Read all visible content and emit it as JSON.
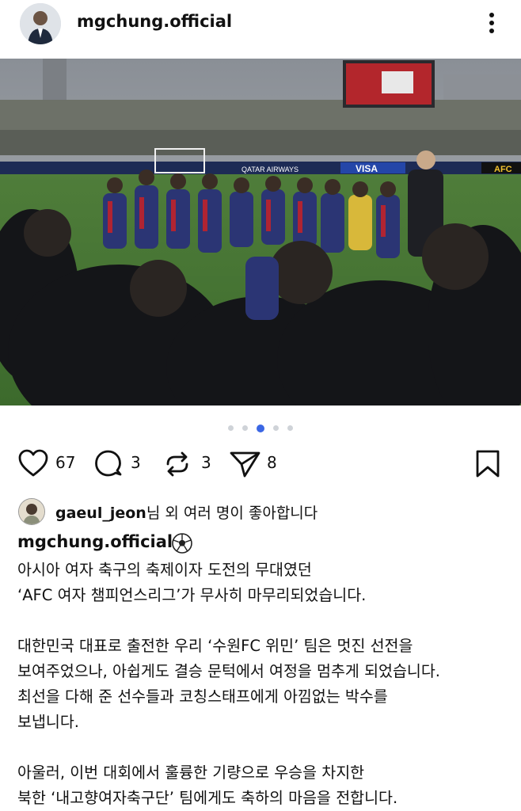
{
  "header": {
    "username": "mgchung.official",
    "avatar_icon": "profile-photo",
    "more_icon": "more-vertical-icon"
  },
  "photo": {
    "stadium_banners": [
      "QATAR AIRWAYS",
      "VISA",
      "AFC"
    ],
    "carousel": {
      "count": 5,
      "active_index": 2
    }
  },
  "actions": {
    "likes": "67",
    "comments": "3",
    "reposts": "3",
    "shares": "8"
  },
  "liked_by": {
    "user": "gaeul_jeon",
    "suffix": "님 외 여러 명이 좋아합니다"
  },
  "caption": {
    "username": "mgchung.official",
    "emoji_icon": "soccer-ball-icon",
    "lines": [
      "아시아 여자 축구의 축제이자 도전의 무대였던",
      "‘AFC 여자 챔피언스리그’가 무사히 마무리되었습니다.",
      "",
      "대한민국 대표로 출전한 우리 ‘수원FC 위민’ 팀은 멋진 선전을",
      "보여주었으나, 아쉽게도 결승 문턱에서 여정을 멈추게 되었습니다.",
      "최선을 다해 준 선수들과 코칭스태프에게 아낌없는 박수를",
      "보냅니다.",
      "",
      "아울러, 이번 대회에서 훌륭한 기량으로 우승을 차지한",
      "북한 ‘내고향여자축구단’ 팀에게도 축하의 마음을 전합니다."
    ]
  },
  "colors": {
    "accent_dot": "#3b67e4",
    "text": "#111111"
  }
}
